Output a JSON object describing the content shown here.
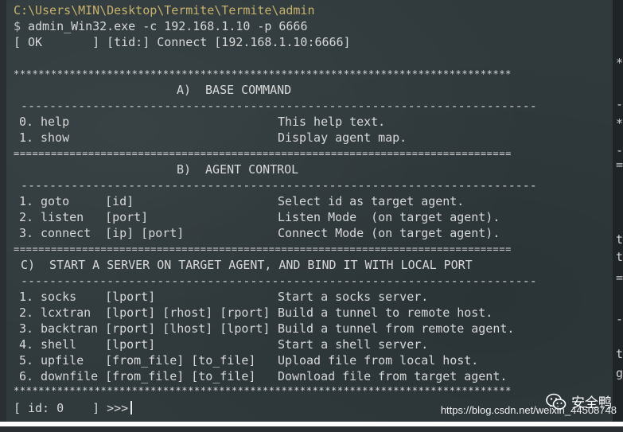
{
  "terminal": {
    "path": "C:\\Users\\MIN\\Desktop\\Termite\\Termite\\admin",
    "prompt_symbol": "$",
    "command": "admin_Win32.exe -c 192.168.1.10 -p 6666",
    "status": "[ OK       ] [tid:] Connect [192.168.1.10:6666]",
    "stars": "********************************************************************************",
    "equals": "================================================================================",
    "dashes": "------------------------------------------------------------------------",
    "section_a": "A)  BASE COMMAND",
    "section_b": "B)  AGENT CONTROL",
    "section_c": "C)  START A SERVER ON TARGET AGENT, AND BIND IT WITH LOCAL PORT",
    "base_commands": [
      {
        "cmd": "0. help",
        "desc": "This help text."
      },
      {
        "cmd": "1. show",
        "desc": "Display agent map."
      }
    ],
    "agent_commands": [
      {
        "cmd": "1. goto     [id]",
        "desc": "Select id as target agent."
      },
      {
        "cmd": "2. listen   [port]",
        "desc": "Listen Mode  (on target agent)."
      },
      {
        "cmd": "3. connect  [ip] [port]",
        "desc": "Connect Mode (on target agent)."
      }
    ],
    "server_commands": [
      {
        "cmd": "1. socks    [lport]",
        "desc": "Start a socks server."
      },
      {
        "cmd": "2. lcxtran  [lport] [rhost] [rport]",
        "desc": "Build a tunnel to remote host."
      },
      {
        "cmd": "3. backtran [rport] [lhost] [lport]",
        "desc": "Build a tunnel from remote agent."
      },
      {
        "cmd": "4. shell    [lport]",
        "desc": "Start a shell server."
      },
      {
        "cmd": "5. upfile   [from_file] [to_file]",
        "desc": "Upload file from local host."
      },
      {
        "cmd": "6. downfile [from_file] [to_file]",
        "desc": "Download file from target agent."
      }
    ],
    "input_prompt": "[ id: 0    ] >>>"
  },
  "background_window": {
    "glyphs": [
      "*",
      "-",
      "*",
      "-",
      "=",
      "t",
      "t",
      "=",
      "-",
      "t",
      "g"
    ]
  },
  "watermark": {
    "brand": "安全鸭",
    "url": "https://blog.csdn.net/weixin_44508748"
  },
  "colors": {
    "terminal_bg": "#303a3d",
    "path_text": "#c7b26b",
    "text": "#d8d8d8"
  }
}
